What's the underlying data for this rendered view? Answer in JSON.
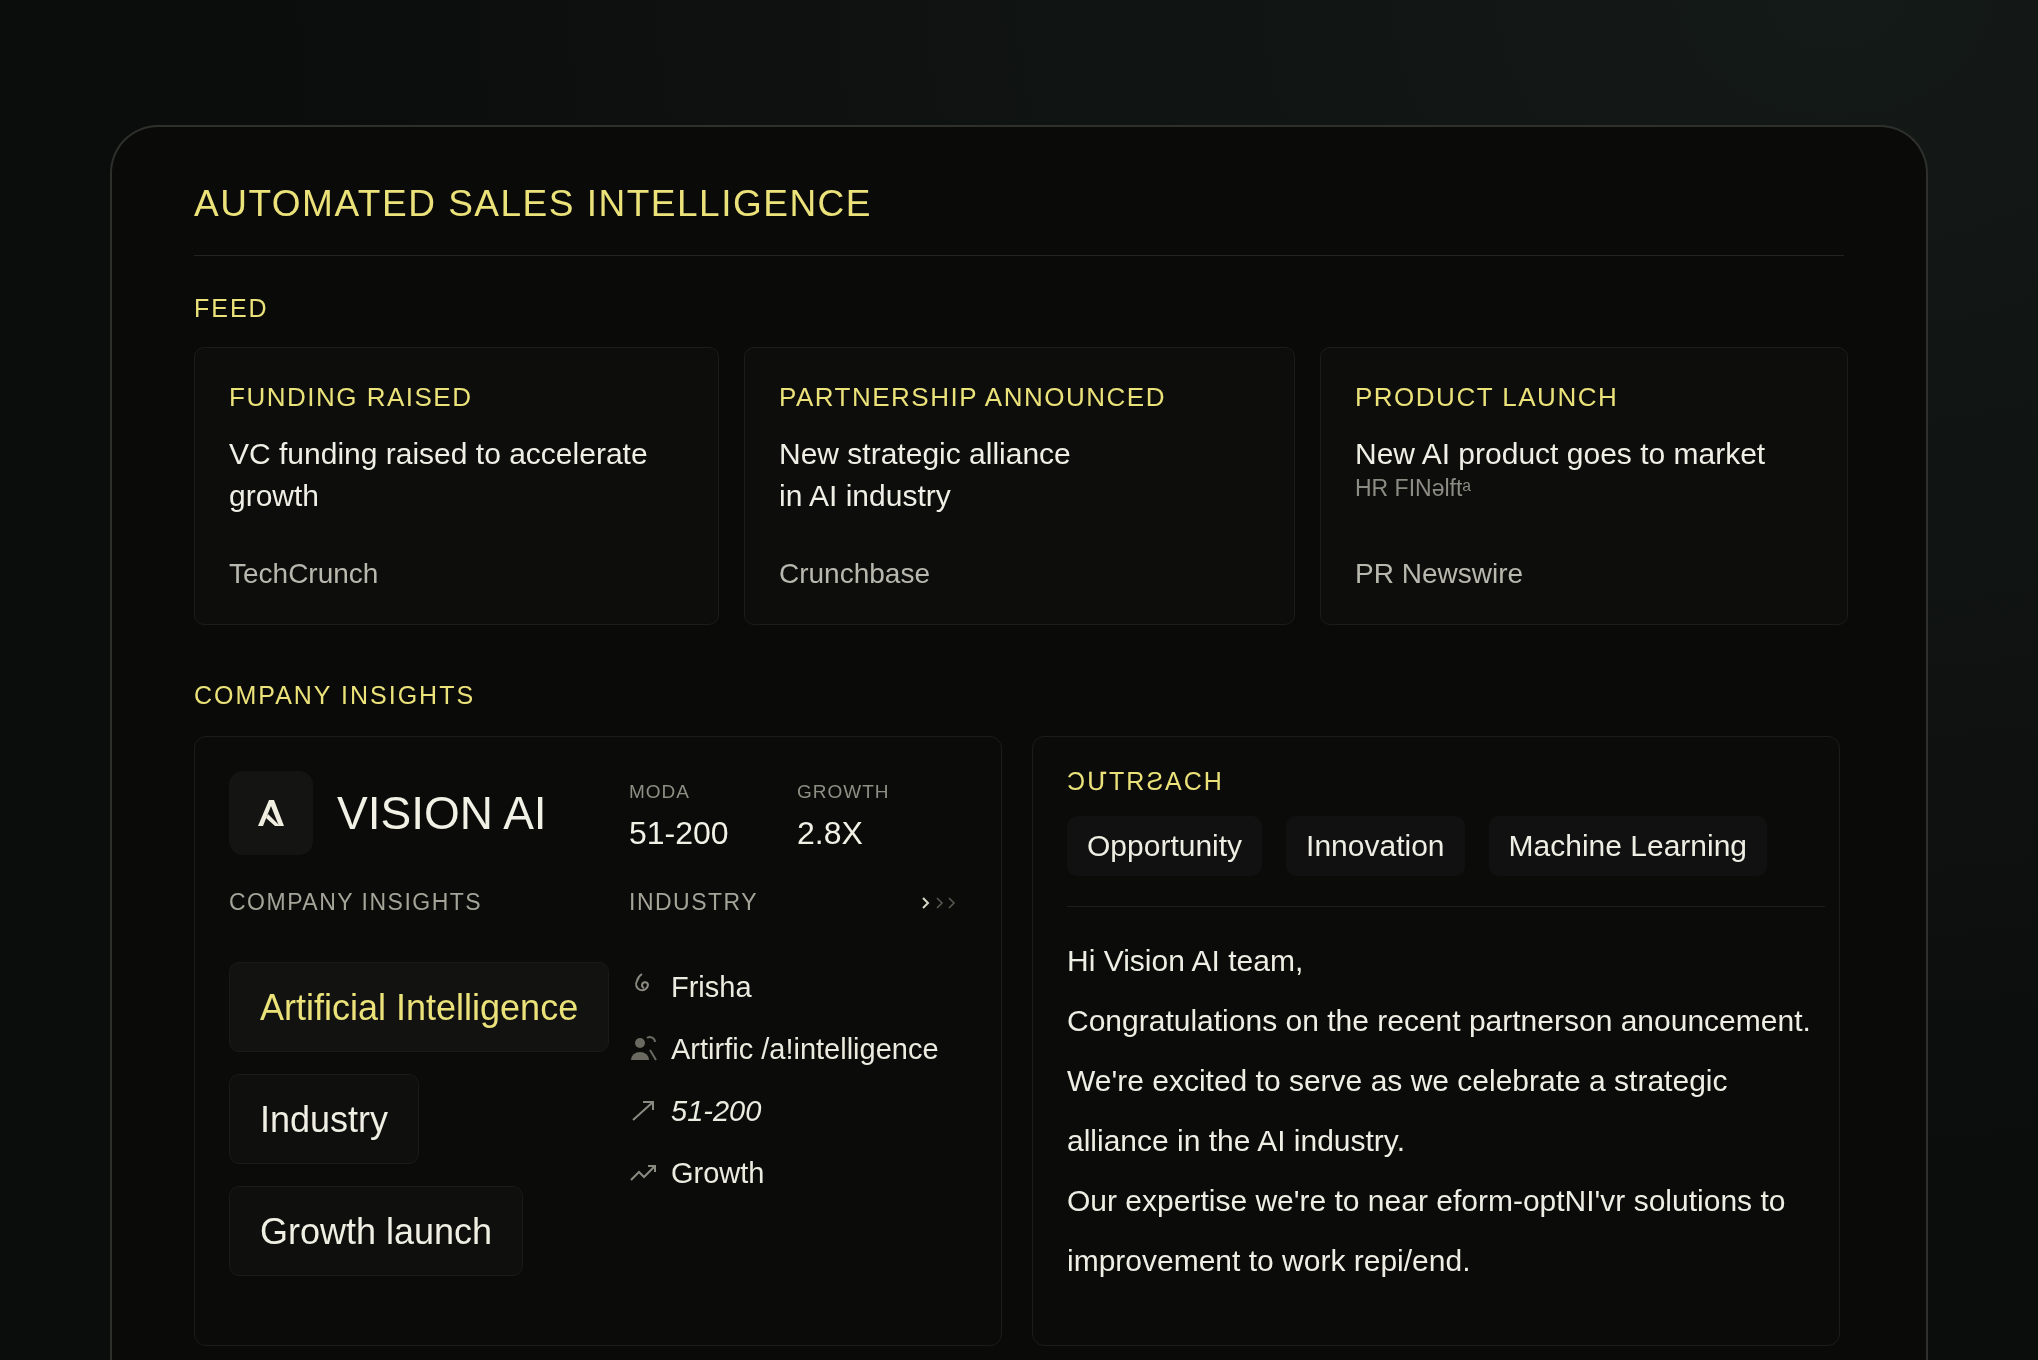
{
  "title": "AUTOMATED SALES INTELLIGENCE",
  "feed": {
    "label": "FEED",
    "cards": [
      {
        "category": "FUNDING RAISED",
        "headline": "VC funding raised to accelerate growth",
        "source": "TechCrunch"
      },
      {
        "category": "PARTNERSHIP ANNOUNCED",
        "headline": "New strategic alliance\nin AI industry",
        "source": "Crunchbase"
      },
      {
        "category": "PRODUCT LAUNCH",
        "headline": "New AI product goes to market",
        "note": "HR FINəlftᵃ",
        "source": "PR Newswire"
      }
    ]
  },
  "insights": {
    "label": "COMPANY INSIGHTS",
    "company": {
      "name": "VISION AI",
      "stats": [
        {
          "label": "MODA",
          "value": "51-200"
        },
        {
          "label": "GROWTH",
          "value": "2.8X"
        }
      ]
    },
    "tags_label": "COMPANY INSIGHTS",
    "tags": [
      {
        "label": "Artificial Intelligence",
        "selected": true
      },
      {
        "label": "Industry",
        "selected": false
      },
      {
        "label": "Growth launch",
        "selected": false
      }
    ],
    "industry_label": "INDUSTRY",
    "industry_items": [
      {
        "kind": "spiral",
        "text": "Frisha"
      },
      {
        "kind": "people",
        "text": "Artirfic /a!intelligence"
      },
      {
        "kind": "arrow",
        "text": "51-200"
      },
      {
        "kind": "trend",
        "text": "Growth"
      }
    ]
  },
  "outreach": {
    "label": "ƆՄTRƧACH",
    "tags": [
      "Opportunity",
      "Innovation",
      "Machine Learning"
    ],
    "paragraphs": [
      "Hi Vision AI team,",
      "Congratulations on the recent partnerson anouncement.",
      "We're excited to serve as we celebrate a strategic alliance in the AI industry.",
      "Our expertise we're to near eform-optNI'vr solutions to improvement to work repi/end."
    ]
  }
}
